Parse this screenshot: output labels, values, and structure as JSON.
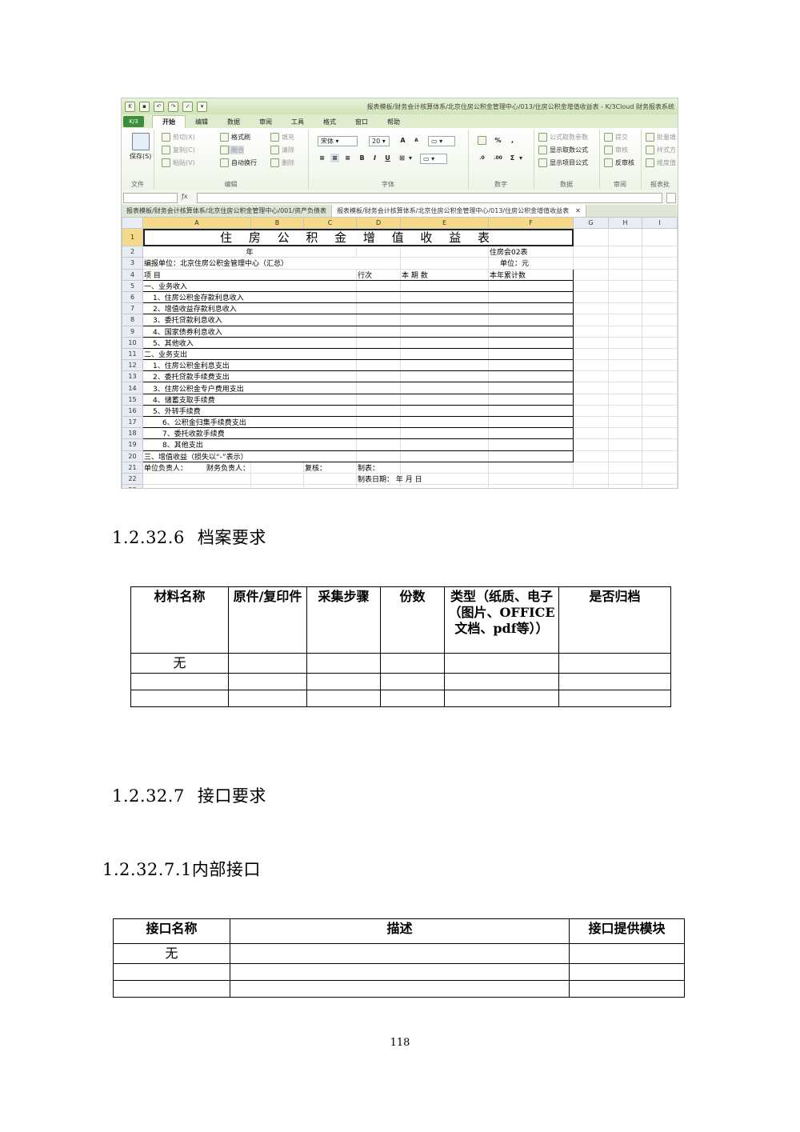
{
  "screenshot": {
    "window_title": "报表模板/财务会计核算体系/北京住房公积金管理中心/013/住房公积金增值收益表 - K/3Cloud 财务报表系统",
    "ribbon_tabs": [
      "开始",
      "编辑",
      "数据",
      "审阅",
      "工具",
      "格式",
      "窗口",
      "帮助"
    ],
    "active_tab": "开始",
    "ribbon": {
      "save": "保存(S)",
      "cut": "剪切(X)",
      "copy": "复制(C)",
      "paste": "粘贴(V)",
      "format_painter": "格式刷",
      "merge": "融合",
      "wrap": "自动换行",
      "fill": "填充",
      "clear": "清除",
      "delete": "删除",
      "font_name": "宋体",
      "font_size": "20",
      "bold": "B",
      "italic": "I",
      "underline": "U",
      "percent": "%",
      "comma": ",",
      "sigma": "Σ",
      "formula_value": "公式取数参数",
      "show_formula": "显示取数公式",
      "show_item_formula": "显示项目公式",
      "submit": "提交",
      "audit": "审核",
      "unaudit": "反审核",
      "batch": "批量填",
      "style": "样式方",
      "dim": "维度值",
      "groups": {
        "file": "文件",
        "edit": "编辑",
        "font": "字体",
        "number": "数字",
        "data": "数据",
        "review": "审阅",
        "report_batch": "报表批"
      }
    },
    "doc_tabs": [
      "报表模板/财务会计核算体系/北京住房公积金管理中心/001/资产负债表",
      "报表模板/财务会计核算体系/北京住房公积金管理中心/013/住房公积金增值收益表"
    ],
    "columns": [
      "A",
      "B",
      "C",
      "D",
      "E",
      "F",
      "G",
      "H",
      "I"
    ],
    "rows": {
      "r1_title": "住 房 公 积 金 增 值 收 益 表",
      "r2_year": "年",
      "r2_code": "住房会02表",
      "r3_unit": "编报单位：北京住房公积金管理中心（汇总）",
      "r3_currency": "单位：元",
      "r4_item": "项          目",
      "r4_line": "行次",
      "r4_current": "本    期    数",
      "r4_cumulative": "本年累计数",
      "items": [
        "一、业务收入",
        "1、住房公积金存款利息收入",
        "2、增值收益存款利息收入",
        "3、委托贷款利息收入",
        "4、国家债券利息收入",
        "5、其他收入",
        "二、业务支出",
        "1、住房公积金利息支出",
        "2、委托贷款手续费支出",
        "3、住房公积金专户费用支出",
        "4、储蓄支取手续费",
        "5、外转手续费",
        "6、公积金归集手续费支出",
        "7、委托收款手续费",
        "8、其他支出",
        "三、增值收益（损失以“-”表示）"
      ],
      "r21_head": "单位负责人：",
      "r21_finance": "财务负责人：",
      "r21_review": "复核：",
      "r21_maker": "制表：",
      "r22_date": "制表日期：  年  月  日"
    }
  },
  "section_6": {
    "number": "1.2.32.6",
    "title": "档案要求"
  },
  "archive_table": {
    "headers": [
      "材料名称",
      "原件/复印件",
      "采集步骤",
      "份数",
      "类型（纸质、电子（图片、OFFICE文档、pdf等））",
      "是否归档"
    ],
    "rows": [
      [
        "无",
        "",
        "",
        "",
        "",
        ""
      ],
      [
        "",
        "",
        "",
        "",
        "",
        ""
      ],
      [
        "",
        "",
        "",
        "",
        "",
        ""
      ]
    ]
  },
  "section_7": {
    "number": "1.2.32.7",
    "title": "接口要求"
  },
  "section_7_1": {
    "number": "1.2.32.7.1",
    "title": "内部接口"
  },
  "interface_table": {
    "headers": [
      "接口名称",
      "描述",
      "接口提供模块"
    ],
    "rows": [
      [
        "无",
        "",
        ""
      ],
      [
        "",
        "",
        ""
      ],
      [
        "",
        "",
        ""
      ]
    ]
  },
  "page_number": "118"
}
